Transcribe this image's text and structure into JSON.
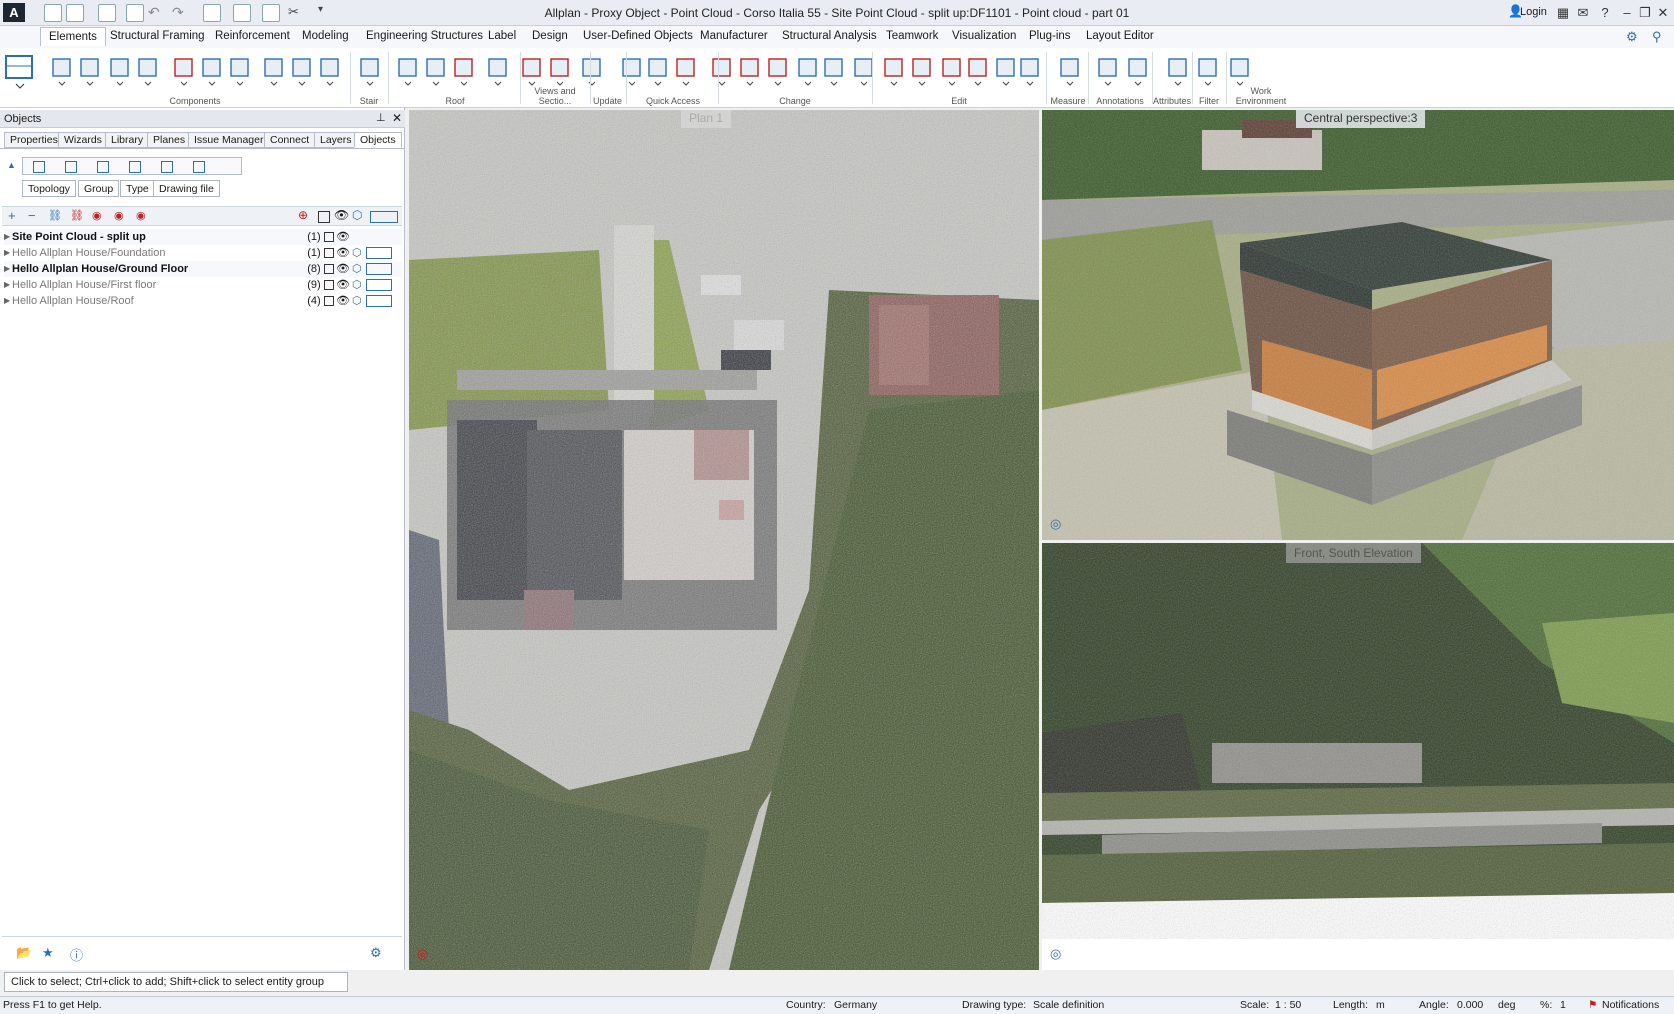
{
  "title": "Allplan - Proxy Object - Point Cloud - Corso Italia 55 - Site Point Cloud - split up:DF1101 - Point cloud - part 01",
  "login": "Login",
  "menu": [
    "Elements",
    "Structural Framing",
    "Reinforcement",
    "Modeling",
    "Engineering Structures",
    "Label",
    "Design",
    "User-Defined Objects",
    "Manufacturer",
    "Structural Analysis",
    "Teamwork",
    "Visualization",
    "Plug-ins",
    "Layout Editor"
  ],
  "ribbon_groups": [
    "Components",
    "Stair",
    "Roof",
    "Views and Sectio...",
    "Update",
    "Quick Access",
    "Change",
    "Edit",
    "Measure",
    "Annotations",
    "Attributes",
    "Filter",
    "Work Environment"
  ],
  "panel": {
    "title": "Objects",
    "tabs": [
      "Properties",
      "Wizards",
      "Library",
      "Planes",
      "Issue Manager",
      "Connect",
      "Layers",
      "Objects"
    ],
    "chips": [
      "Topology",
      "Group",
      "Type",
      "Drawing file"
    ],
    "rows": [
      {
        "name": "Site Point Cloud - split up",
        "count": "(1)"
      },
      {
        "name": "Hello Allplan House/Foundation",
        "count": "(1)"
      },
      {
        "name": "Hello Allplan House/Ground Floor",
        "count": "(8)"
      },
      {
        "name": "Hello Allplan House/First floor",
        "count": "(9)"
      },
      {
        "name": "Hello Allplan House/Roof",
        "count": "(4)"
      }
    ]
  },
  "views": {
    "plan": "Plan 1",
    "perspective": "Central perspective:3",
    "elevation": "Front, South Elevation"
  },
  "hint": "Click to select; Ctrl+click to add; Shift+click to select entity group",
  "status": {
    "help": "Press F1 to get Help.",
    "country_label": "Country:",
    "country": "Germany",
    "drawing_type_label": "Drawing type:",
    "drawing_type": "Scale definition",
    "scale_label": "Scale:",
    "scale": "1 : 50",
    "length_label": "Length:",
    "length": "m",
    "angle_label": "Angle:",
    "angle": "0.000",
    "angle_unit": "deg",
    "percent_label": "%:",
    "percent": "1",
    "notifications": "Notifications"
  },
  "colors": {
    "accent": "#2d6fb7",
    "grass": "#6f8a3a",
    "roof": "#3c4a3e"
  }
}
